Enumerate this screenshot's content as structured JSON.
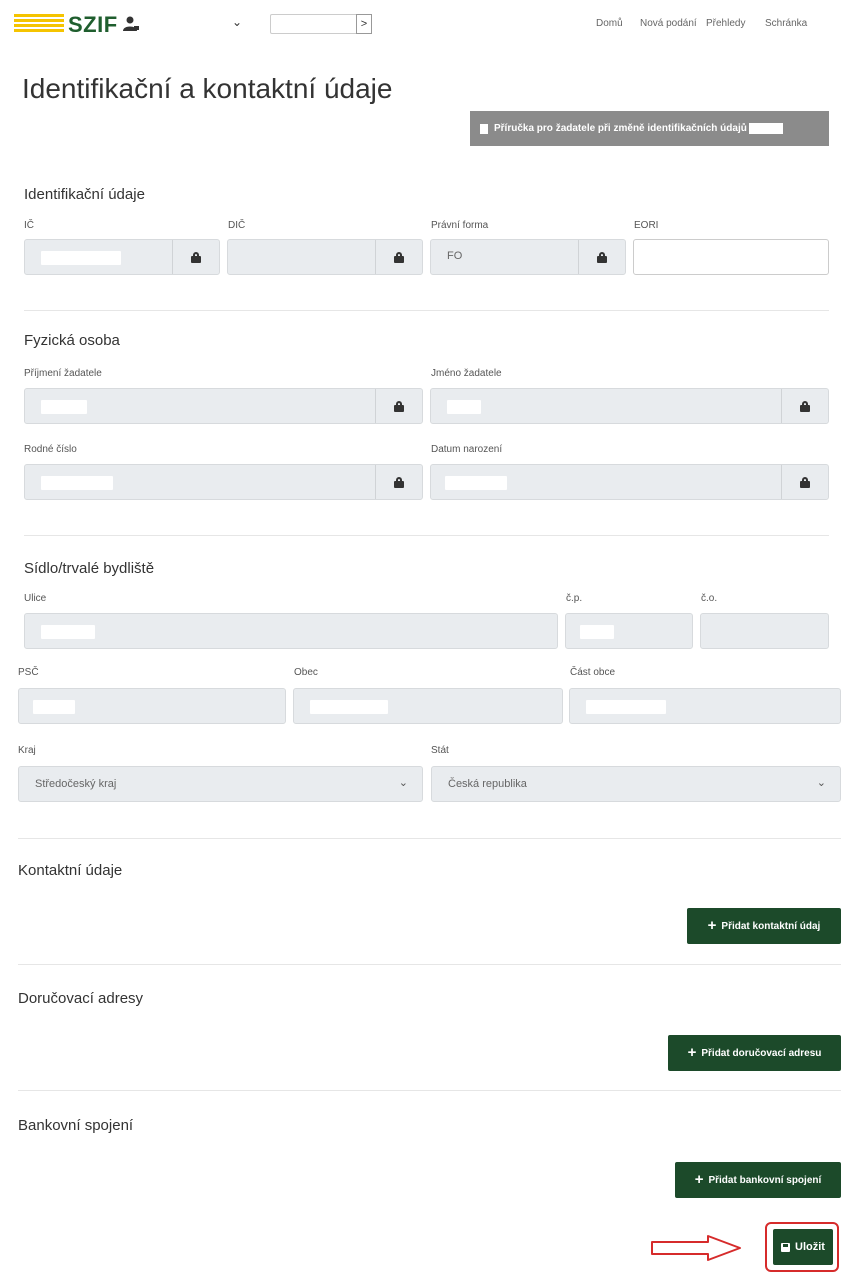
{
  "header": {
    "logo_text": "SZIF",
    "nav": [
      "Domů",
      "Nová podání",
      "Přehledy",
      "Schránka"
    ],
    "subject_arrow": ">",
    "user_chevron": "⌄"
  },
  "page": {
    "title": "Identifikační a kontaktní údaje",
    "guide_button": "Příručka pro žadatele při změně identifikačních údajů"
  },
  "identifikacni": {
    "title": "Identifikační údaje",
    "ic_label": "IČ",
    "dic_label": "DIČ",
    "pravni_forma_label": "Právní forma",
    "pravni_forma_value": "FO",
    "eori_label": "EORI"
  },
  "fyzicka": {
    "title": "Fyzická osoba",
    "prijmeni_label": "Příjmení žadatele",
    "jmeno_label": "Jméno žadatele",
    "rodne_cislo_label": "Rodné číslo",
    "datum_label": "Datum narození"
  },
  "sidlo": {
    "title": "Sídlo/trvalé bydliště",
    "ulice_label": "Ulice",
    "cp_label": "č.p.",
    "co_label": "č.o.",
    "psc_label": "PSČ",
    "obec_label": "Obec",
    "cast_obce_label": "Část obce",
    "kraj_label": "Kraj",
    "kraj_value": "Středočeský kraj",
    "stat_label": "Stát",
    "stat_value": "Česká republika"
  },
  "kontaktni": {
    "title": "Kontaktní údaje",
    "button": "Přidat kontaktní údaj"
  },
  "dorucovaci": {
    "title": "Doručovací adresy",
    "button": "Přidat doručovací adresu"
  },
  "bankovni": {
    "title": "Bankovní spojení",
    "button": "Přidat bankovní spojení"
  },
  "save": {
    "label": "Uložit"
  },
  "colors": {
    "primary_green": "#1c4a2a",
    "logo_green": "#1f5e2e",
    "logo_yellow": "#f5c400",
    "guide_gray": "#8b8b8b",
    "highlight_red": "#d62b2b"
  }
}
